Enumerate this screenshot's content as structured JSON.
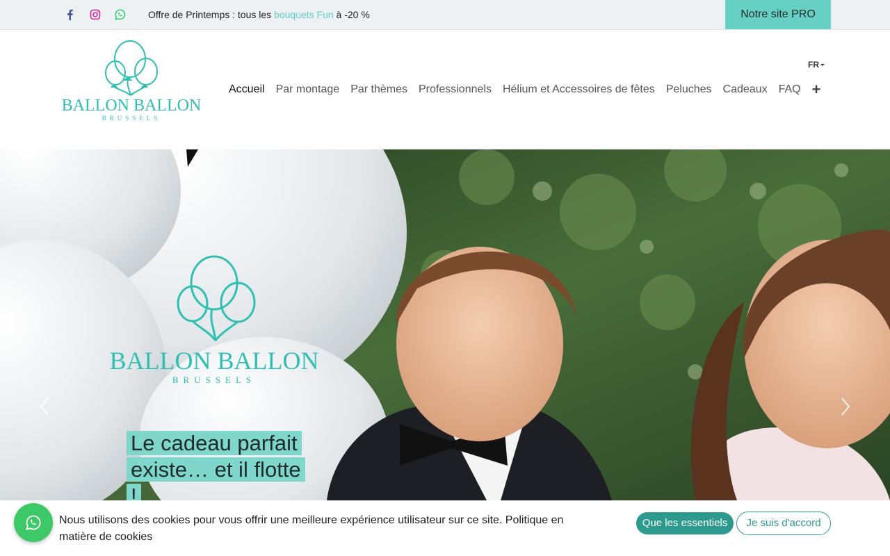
{
  "topbar": {
    "icons": [
      "facebook-icon",
      "instagram-icon",
      "whatsapp-icon"
    ],
    "promo_prefix": "Offre de Printemps : tous les ",
    "promo_link": "bouquets Fun",
    "promo_suffix": " à -20 %",
    "pro_button": "Notre site PRO"
  },
  "header": {
    "logo_line1": "BALLON BALLON",
    "logo_line2": "BRUSSELS",
    "language": "FR",
    "nav": [
      {
        "label": "Accueil",
        "active": true
      },
      {
        "label": "Par montage"
      },
      {
        "label": "Par thèmes"
      },
      {
        "label": "Professionnels"
      },
      {
        "label": "Hélium et Accessoires de fêtes"
      },
      {
        "label": "Peluches"
      },
      {
        "label": "Cadeaux"
      },
      {
        "label": "FAQ"
      }
    ],
    "nav_more": "+"
  },
  "hero": {
    "logo_line1": "BALLON BALLON",
    "logo_line2": "BRUSSELS",
    "tagline": "Le cadeau parfait existe… et il flotte !"
  },
  "cookie": {
    "text": "Nous utilisons des cookies pour vous offrir une meilleure expérience utilisateur sur ce site.  Politique en matière de cookies",
    "essential_button": "Que les essentiels",
    "accept_button": "Je suis d'accord"
  },
  "colors": {
    "brand_teal": "#2fbfb3",
    "accent_light": "#67d0c4",
    "button_dark": "#2c9a8d",
    "whatsapp_green": "#3ec969"
  }
}
